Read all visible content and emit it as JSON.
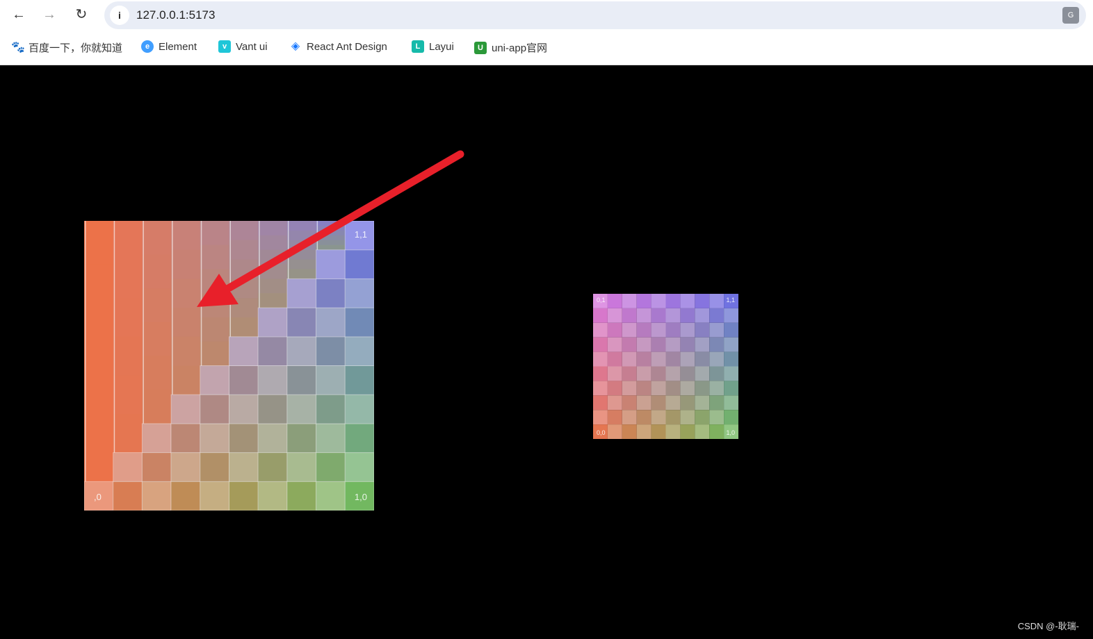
{
  "browser": {
    "url": "127.0.0.1:5173",
    "nav": {
      "back_icon": "arrow-left",
      "forward_icon": "arrow-right",
      "reload_icon": "reload"
    },
    "bookmarks": [
      {
        "label": "百度一下，你就知道",
        "icon": "baidu-paw",
        "color": "#2932e1"
      },
      {
        "label": "Element",
        "icon": "element-hex",
        "color": "#409eff"
      },
      {
        "label": "Vant ui",
        "icon": "vant",
        "color": "#1fc6d8"
      },
      {
        "label": "React Ant Design",
        "icon": "ant-diamond",
        "color": "#1677ff"
      },
      {
        "label": "Layui",
        "icon": "layui",
        "color": "#16baaa"
      },
      {
        "label": "uni-app官网",
        "icon": "uni-app",
        "color": "#2b9939"
      }
    ]
  },
  "canvas": {
    "background": "#000000",
    "left_texture": {
      "corner_labels": {
        "bottom_left": ",0",
        "bottom_right": "1,0",
        "top_right": "1,1"
      }
    },
    "right_texture": {
      "grid": 10,
      "corner_labels": {
        "top_left": "0,1",
        "top_right": "1,1",
        "bottom_left": "0,0",
        "bottom_right": "1,0"
      }
    },
    "colors": {
      "bottom_left": "#ec7249",
      "top_left": "#da78e2",
      "top_right": "#6a6ee8",
      "bottom_right": "#6cc05a",
      "arrow": "#e8202a"
    }
  },
  "footer": "CSDN @-耿瑞-"
}
